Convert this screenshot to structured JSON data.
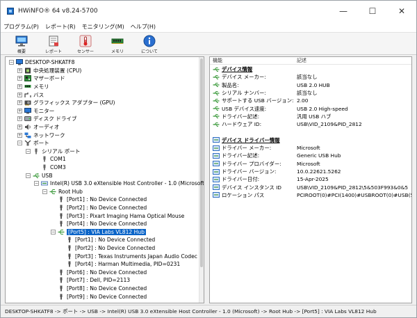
{
  "window": {
    "title": "HWiNFO® 64 v8.24-5700",
    "minimize_glyph": "—",
    "maximize_glyph": "☐",
    "close_glyph": "✕"
  },
  "menu": [
    "プログラム(P)",
    "レポート(R)",
    "モニタリング(M)",
    "ヘルプ(H)"
  ],
  "toolbar": [
    {
      "label": "概要",
      "icon": "monitor-icon"
    },
    {
      "label": "レポート",
      "icon": "report-icon"
    },
    {
      "label": "センサー",
      "icon": "thermometer-icon"
    },
    {
      "label": "メモリ",
      "icon": "memory-icon"
    },
    {
      "label": "について",
      "icon": "info-icon"
    }
  ],
  "tree": [
    {
      "label": "DESKTOP-SHKATF8",
      "level": 0,
      "expander": "−",
      "icon": "computer-icon"
    },
    {
      "label": "中央処理装置 (CPU)",
      "level": 1,
      "expander": "+",
      "icon": "cpu-icon"
    },
    {
      "label": "マザーボード",
      "level": 1,
      "expander": "+",
      "icon": "motherboard-icon"
    },
    {
      "label": "メモリ",
      "level": 1,
      "expander": "+",
      "icon": "memory-icon"
    },
    {
      "label": "バス",
      "level": 1,
      "expander": "+",
      "icon": "bus-icon"
    },
    {
      "label": "グラフィックス アダプター (GPU)",
      "level": 1,
      "expander": "+",
      "icon": "gpu-icon"
    },
    {
      "label": "モニター",
      "level": 1,
      "expander": "+",
      "icon": "monitor-icon"
    },
    {
      "label": "ディスク ドライブ",
      "level": 1,
      "expander": "+",
      "icon": "disk-icon"
    },
    {
      "label": "オーディオ",
      "level": 1,
      "expander": "+",
      "icon": "audio-icon"
    },
    {
      "label": "ネットワーク",
      "level": 1,
      "expander": "+",
      "icon": "network-icon"
    },
    {
      "label": "ポート",
      "level": 1,
      "expander": "−",
      "icon": "port-icon"
    },
    {
      "label": "シリアル ポート",
      "level": 2,
      "expander": "−",
      "icon": "serial-port-icon"
    },
    {
      "label": "COM1",
      "level": 3,
      "expander": "",
      "icon": "serial-port-icon"
    },
    {
      "label": "COM3",
      "level": 3,
      "expander": "",
      "icon": "serial-port-icon"
    },
    {
      "label": "USB",
      "level": 2,
      "expander": "−",
      "icon": "usb-icon"
    },
    {
      "label": "Intel(R) USB 3.0 eXtensible Host Controller - 1.0 (Microsoft)",
      "level": 3,
      "expander": "−",
      "icon": "usb-controller-icon"
    },
    {
      "label": "Root Hub",
      "level": 4,
      "expander": "−",
      "icon": "usb-hub-icon"
    },
    {
      "label": "[Port1] : No Device Connected",
      "level": 5,
      "expander": "",
      "icon": "usb-plug-icon"
    },
    {
      "label": "[Port2] : No Device Connected",
      "level": 5,
      "expander": "",
      "icon": "usb-plug-icon"
    },
    {
      "label": "[Port3] : Pixart Imaging Hama Optical Mouse",
      "level": 5,
      "expander": "",
      "icon": "usb-plug-icon"
    },
    {
      "label": "[Port4] : No Device Connected",
      "level": 5,
      "expander": "",
      "icon": "usb-plug-icon"
    },
    {
      "label": "[Port5] : VIA Labs VL812 Hub",
      "level": 5,
      "expander": "−",
      "icon": "usb-hub-icon",
      "selected": true
    },
    {
      "label": "[Port1] : No Device Connected",
      "level": 6,
      "expander": "",
      "icon": "usb-plug-icon"
    },
    {
      "label": "[Port2] : No Device Connected",
      "level": 6,
      "expander": "",
      "icon": "usb-plug-icon"
    },
    {
      "label": "[Port3] : Texas Instruments Japan Audio Codec",
      "level": 6,
      "expander": "",
      "icon": "usb-plug-icon"
    },
    {
      "label": "[Port4] : Harman Multimedia, PID=0231",
      "level": 6,
      "expander": "",
      "icon": "usb-plug-icon"
    },
    {
      "label": "[Port6] : No Device Connected",
      "level": 5,
      "expander": "",
      "icon": "usb-plug-icon"
    },
    {
      "label": "[Port7] : Dell, PID=2113",
      "level": 5,
      "expander": "",
      "icon": "usb-plug-icon"
    },
    {
      "label": "[Port8] : No Device Connected",
      "level": 5,
      "expander": "",
      "icon": "usb-plug-icon"
    },
    {
      "label": "[Port9] : No Device Connected",
      "level": 5,
      "expander": "",
      "icon": "usb-plug-icon"
    }
  ],
  "details": {
    "header_feature": "機能",
    "header_desc": "記述",
    "rows": [
      {
        "k": "デバイス情報",
        "v": "",
        "type": "section",
        "icon": "usb-icon"
      },
      {
        "k": "デバイス メーカー:",
        "v": "該当なし",
        "type": "item",
        "icon": "usb-icon"
      },
      {
        "k": "製品名:",
        "v": "USB 2.0 HUB",
        "type": "item",
        "icon": "usb-icon"
      },
      {
        "k": "シリアル ナンバー:",
        "v": "該当なし",
        "type": "item",
        "icon": "usb-icon"
      },
      {
        "k": "サポートする USB バージョン:",
        "v": "2.00",
        "type": "item",
        "icon": "usb-icon"
      },
      {
        "k": "USB デバイス速度:",
        "v": "USB 2.0 High-speed",
        "type": "item",
        "icon": "usb-icon"
      },
      {
        "k": "ドライバー記述:",
        "v": "汎用 USB ハブ",
        "type": "item",
        "icon": "usb-icon"
      },
      {
        "k": "ハードウェア ID:",
        "v": "USB\\VID_2109&PID_2812",
        "type": "item",
        "icon": "usb-icon"
      },
      {
        "k": "",
        "v": "",
        "type": "blank"
      },
      {
        "k": "デバイス ドライバー情報",
        "v": "",
        "type": "section",
        "icon": "driver-icon"
      },
      {
        "k": "ドライバー メーカー:",
        "v": "Microsoft",
        "type": "item",
        "icon": "driver-icon"
      },
      {
        "k": "ドライバー記述:",
        "v": "Generic USB Hub",
        "type": "item",
        "icon": "driver-icon"
      },
      {
        "k": "ドライバー プロバイダー:",
        "v": "Microsoft",
        "type": "item",
        "icon": "driver-icon"
      },
      {
        "k": "ドライバー バージョン:",
        "v": "10.0.22621.5262",
        "type": "item",
        "icon": "driver-icon"
      },
      {
        "k": "ドライバー日付:",
        "v": "15-Apr-2025",
        "type": "item",
        "icon": "driver-icon"
      },
      {
        "k": "デバイス インスタンス ID",
        "v": "USB\\VID_2109&PID_2812\\5&503F993&0&5",
        "type": "item",
        "icon": "driver-icon"
      },
      {
        "k": "ロケーション パス",
        "v": "PCIROOT(0)#PCI(1400)#USBROOT(0)#USB(5)",
        "type": "item",
        "icon": "driver-icon"
      }
    ]
  },
  "status": "DESKTOP-SHKATF8 -> ポート -> USB -> Intel(R) USB 3.0 eXtensible Host Controller - 1.0 (Microsoft) -> Root Hub -> [Port5] : VIA Labs VL812 Hub",
  "colors": {
    "selection": "#0a64c8",
    "usb_icon": "#3c9a3c",
    "driver_icon": "#2f6fc0"
  }
}
